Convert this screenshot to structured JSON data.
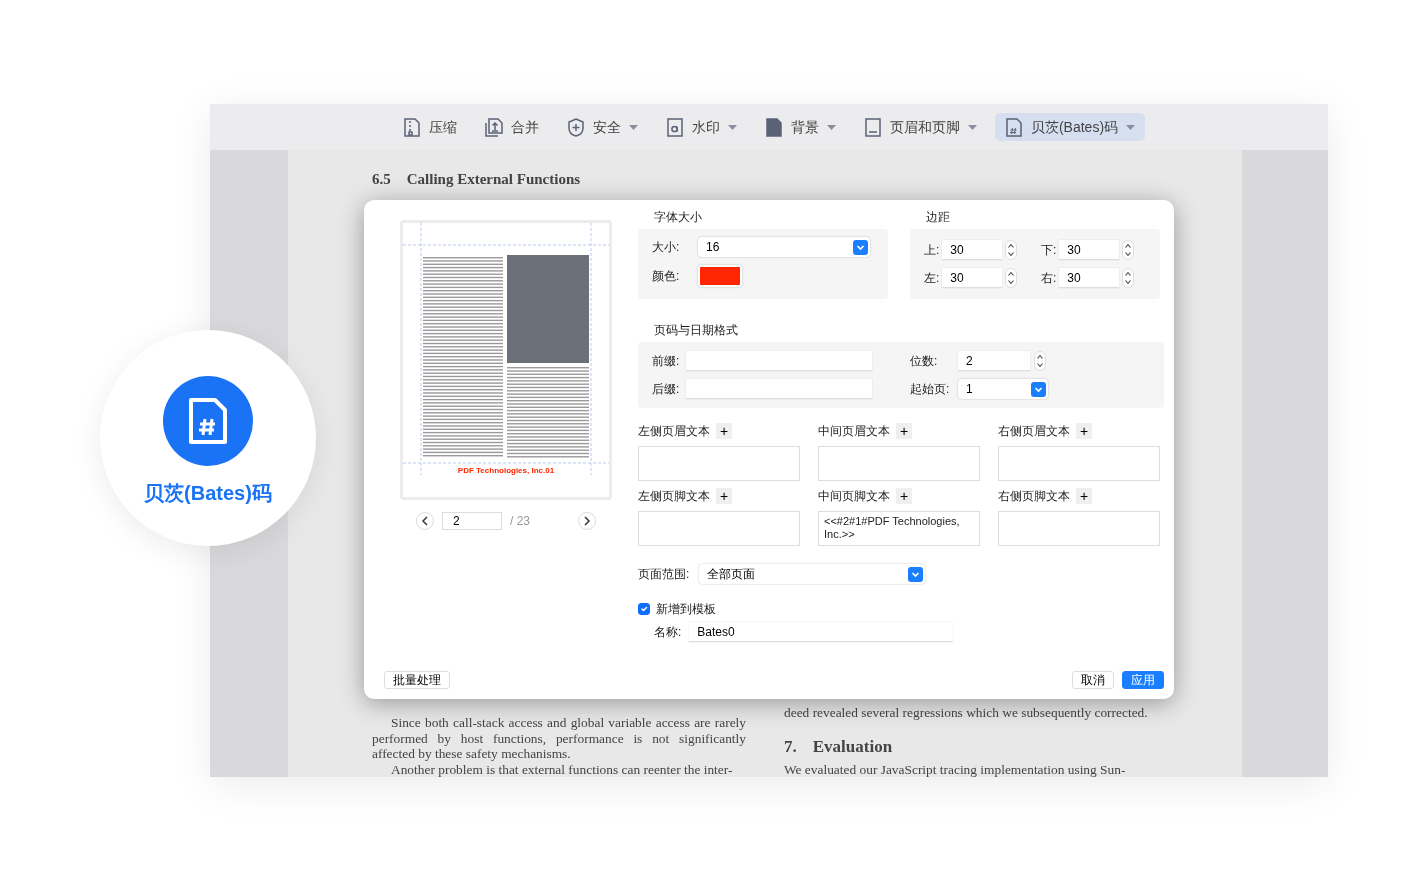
{
  "toolbar": [
    {
      "label": "压缩",
      "dropdown": false,
      "selected": false
    },
    {
      "label": "合并",
      "dropdown": false,
      "selected": false
    },
    {
      "label": "安全",
      "dropdown": true,
      "selected": false
    },
    {
      "label": "水印",
      "dropdown": true,
      "selected": false
    },
    {
      "label": "背景",
      "dropdown": true,
      "selected": false
    },
    {
      "label": "页眉和页脚",
      "dropdown": true,
      "selected": false
    },
    {
      "label": "贝茨(Bates)码",
      "dropdown": true,
      "selected": true
    }
  ],
  "document": {
    "heading_number": "6.5",
    "heading": "Calling External Functions",
    "left_paragraphs": [
      "Since both call-stack access and global variable access are rarely performed by host functions, performance is not significantly affected by these safety mechanisms.",
      "Another problem is that external functions can reenter the inter-"
    ],
    "right_line": "deed revealed several regressions which we subsequently corrected.",
    "section_number": "7.",
    "section_title": "Evaluation",
    "right_paragraph": "We evaluated our JavaScript tracing implementation using Sun-"
  },
  "feature_badge": {
    "label": "贝茨(Bates)码"
  },
  "dialog": {
    "preview": {
      "footer_text": "PDF Technologies, Inc.01",
      "page": "2",
      "total": "/ 23"
    },
    "font": {
      "title": "字体大小",
      "size_label": "大小:",
      "size": "16",
      "color_label": "颜色:",
      "color": "#ff2600"
    },
    "margins": {
      "title": "边距",
      "fields": [
        {
          "label": "上:",
          "value": "30"
        },
        {
          "label": "下:",
          "value": "30"
        },
        {
          "label": "左:",
          "value": "30"
        },
        {
          "label": "右:",
          "value": "30"
        }
      ]
    },
    "format": {
      "title": "页码与日期格式",
      "prefix_label": "前缀:",
      "suffix_label": "后缀:",
      "digits_label": "位数:",
      "digits": "2",
      "start_label": "起始页:",
      "start": "1"
    },
    "text_fields": [
      {
        "label": "左侧页眉文本",
        "add": "+"
      },
      {
        "label": "中间页眉文本",
        "add": "+"
      },
      {
        "label": "右侧页眉文本",
        "add": "+"
      },
      {
        "label": "左侧页脚文本",
        "add": "+"
      },
      {
        "label": "中间页脚文本",
        "add": "+",
        "value": "<<#2#1#PDF Technologies, Inc.>>"
      },
      {
        "label": "右侧页脚文本",
        "add": "+"
      }
    ],
    "page_range": {
      "label": "页面范围:",
      "value": "全部页面"
    },
    "template": {
      "checked": true,
      "label": "新增到模板",
      "name_label": "名称:",
      "name": "Bates0"
    },
    "batch_button": "批量处理",
    "cancel_button": "取消",
    "apply_button": "应用"
  }
}
